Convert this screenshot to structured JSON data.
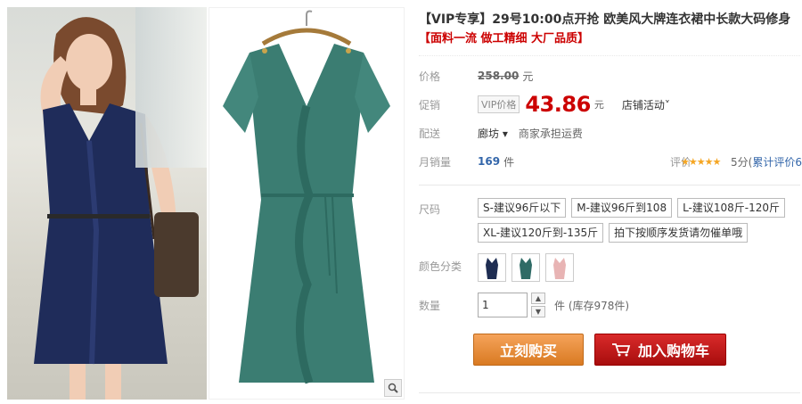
{
  "product": {
    "title": "【VIP专享】29号10:00点开抢 欧美风大牌连衣裙中长款大码修身",
    "subtitle": "【面料一流 做工精细 大厂品质】"
  },
  "price": {
    "label": "价格",
    "original": "258.00",
    "unit": "元"
  },
  "promo": {
    "label": "促销",
    "tag": "VIP价格",
    "price": "43.86",
    "unit": "元",
    "shop_activity": "店铺活动˅"
  },
  "shipping": {
    "label": "配送",
    "from": "廊坊 ▾",
    "note": "商家承担运费"
  },
  "sales": {
    "label": "月销量",
    "count": "169",
    "unit": "件",
    "rating_label": "评价",
    "stars": "★★★★★",
    "score_text": "5分(",
    "rating_count": "累计评价6",
    "close": ")"
  },
  "sku": {
    "size_label": "尺码",
    "sizes": [
      "S-建议96斤以下",
      "M-建议96斤到108",
      "L-建议108斤-120斤",
      "XL-建议120斤到-135斤",
      "拍下按顺序发货请勿催单哦"
    ],
    "color_label": "颜色分类",
    "colors": [
      "#1e2d52",
      "#2f6b66",
      "#e8b4b4"
    ]
  },
  "quantity": {
    "label": "数量",
    "value": "1",
    "unit": "件",
    "stock": "(库存978件)"
  },
  "buttons": {
    "buy": "立刻购买",
    "cart": "加入购物车"
  }
}
